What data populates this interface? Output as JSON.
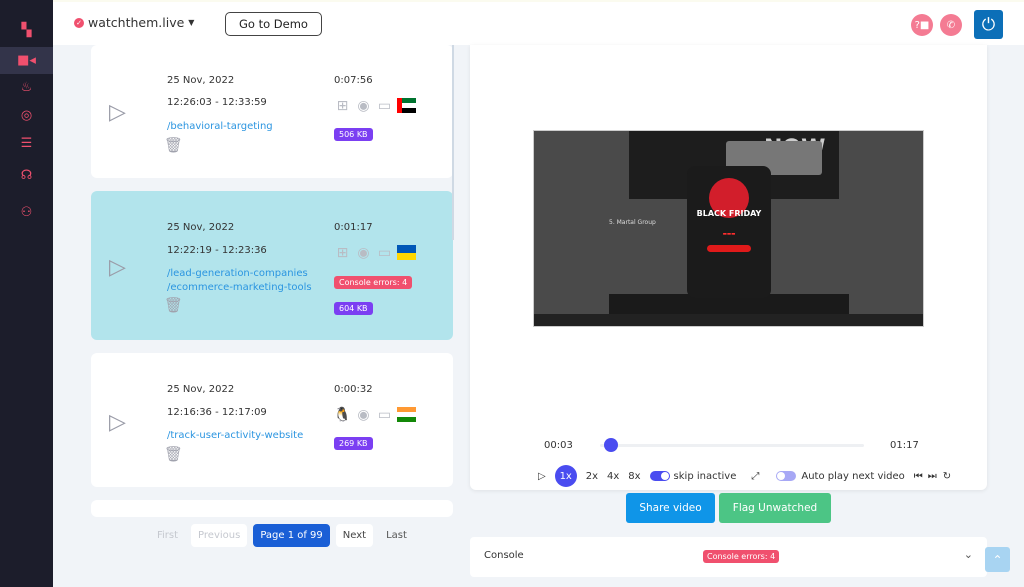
{
  "header": {
    "site": "watchthem.live",
    "demo_button": "Go to Demo"
  },
  "sidebar": {
    "items": [
      {
        "icon": "dashboard-icon"
      },
      {
        "icon": "video-camera-icon",
        "active": true
      },
      {
        "icon": "flame-icon"
      },
      {
        "icon": "target-icon"
      },
      {
        "icon": "server-list-icon"
      },
      {
        "icon": "support-headset-icon"
      },
      {
        "icon": "user-settings-icon"
      }
    ]
  },
  "sessions": [
    {
      "date": "25 Nov, 2022",
      "time": "12:26:03 - 12:33:59",
      "paths": [
        "/behavioral-targeting"
      ],
      "duration": "0:07:56",
      "os": "windows",
      "browser": "chrome",
      "device": "desktop",
      "country": "UAE",
      "size": "506 KB",
      "flag_colors": [
        "#00732f",
        "#ffffff",
        "#000000",
        "#ff0000"
      ]
    },
    {
      "date": "25 Nov, 2022",
      "time": "12:22:19 - 12:23:36",
      "paths": [
        "/lead-generation-companies",
        "/ecommerce-marketing-tools"
      ],
      "duration": "0:01:17",
      "os": "windows",
      "browser": "chrome",
      "device": "desktop",
      "country": "Ukraine",
      "errors": "Console errors: 4",
      "size": "604 KB",
      "selected": true,
      "flag_colors": [
        "#0057b7",
        "#ffd700"
      ]
    },
    {
      "date": "25 Nov, 2022",
      "time": "12:16:36 - 12:17:09",
      "paths": [
        "/track-user-activity-website"
      ],
      "duration": "0:00:32",
      "os": "linux",
      "browser": "chrome",
      "device": "desktop",
      "country": "India",
      "size": "269 KB",
      "flag_colors": [
        "#ff9933",
        "#ffffff",
        "#138808"
      ]
    }
  ],
  "pagination": {
    "first": "First",
    "previous": "Previous",
    "current": "Page 1 of 99",
    "next": "Next",
    "last": "Last"
  },
  "player": {
    "current_time": "00:03",
    "total_time": "01:17",
    "progress_percent": 4,
    "speeds": [
      "1x",
      "2x",
      "4x",
      "8x"
    ],
    "active_speed": "1x",
    "skip_inactive_label": "skip inactive",
    "skip_inactive": true,
    "autoplay_label": "Auto play next video",
    "autoplay": false,
    "preview": {
      "headline": "NOW",
      "section": "5. Martal Group",
      "popup_title": "BLACK FRIDAY"
    }
  },
  "actions": {
    "share": "Share video",
    "flag": "Flag Unwatched"
  },
  "console": {
    "label": "Console",
    "errors": "Console errors: 4"
  },
  "colors": {
    "accent": "#f0506e",
    "primary": "#4a4cf0",
    "selected_row": "#b2e4ec",
    "share": "#0f95e8",
    "flag": "#4cc585"
  }
}
